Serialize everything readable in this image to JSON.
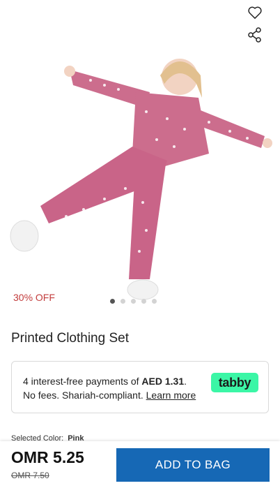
{
  "product": {
    "discount_label": "30% OFF",
    "title": "Printed Clothing Set",
    "image_count": 5,
    "active_image_index": 0
  },
  "tabby": {
    "text_before": "4 interest-free payments of ",
    "amount": "AED 1.31",
    "text_after": ". No fees. Shariah-compliant. ",
    "learn_more": "Learn more",
    "logo_text": "tabby",
    "brand_color": "#3bf6a6"
  },
  "selection": {
    "label": "Selected Color:",
    "value": "Pink"
  },
  "bottom_bar": {
    "price_current": "OMR 5.25",
    "price_original": "OMR 7.50",
    "add_to_bag_label": "ADD TO BAG",
    "button_color": "#1668b5"
  },
  "icons": {
    "wishlist": "heart-icon",
    "share": "share-icon"
  }
}
